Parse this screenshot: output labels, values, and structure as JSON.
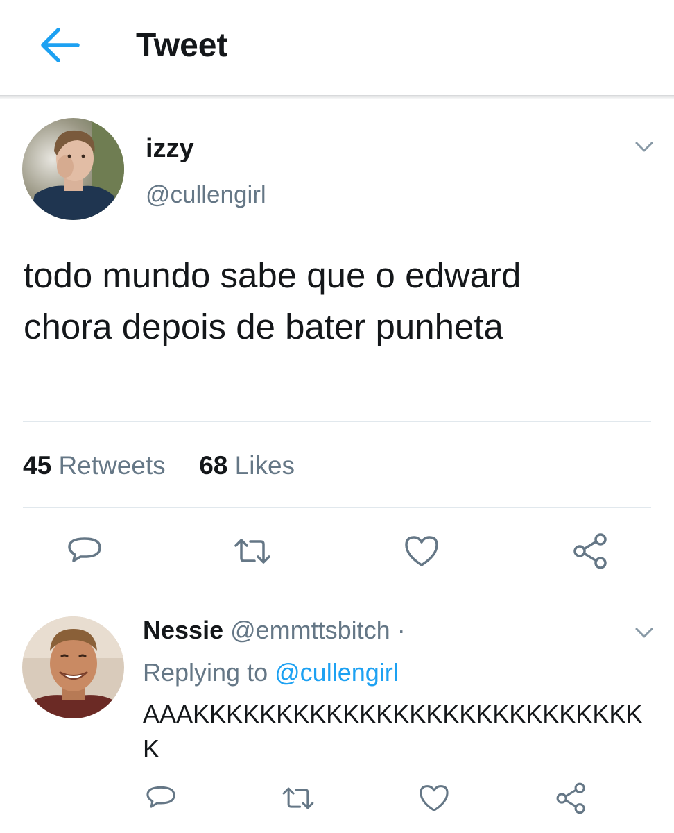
{
  "header": {
    "title": "Tweet",
    "back_icon": "arrow-left-icon"
  },
  "tweet": {
    "display_name": "izzy",
    "handle": "@cullengirl",
    "text": "todo mundo sabe que o edward\nchora depois de bater punheta",
    "retweets_count": "45",
    "retweets_label": "Retweets",
    "likes_count": "68",
    "likes_label": "Likes",
    "actions": [
      "reply-icon",
      "retweet-icon",
      "like-icon",
      "share-icon"
    ]
  },
  "reply": {
    "display_name": "Nessie",
    "handle": "@emmttsbitch",
    "separator": "·",
    "replying_prefix": "Replying to",
    "replying_handle": "@cullengirl",
    "text": "AAAKKKKKKKKKKKKKKKKKKKKKKKKKKKK",
    "actions": [
      "reply-icon",
      "retweet-icon",
      "like-icon",
      "share-icon"
    ]
  },
  "colors": {
    "accent": "#1da1f2",
    "secondary_text": "#657786",
    "divider": "#e1e8ed",
    "icon": "#657786"
  }
}
